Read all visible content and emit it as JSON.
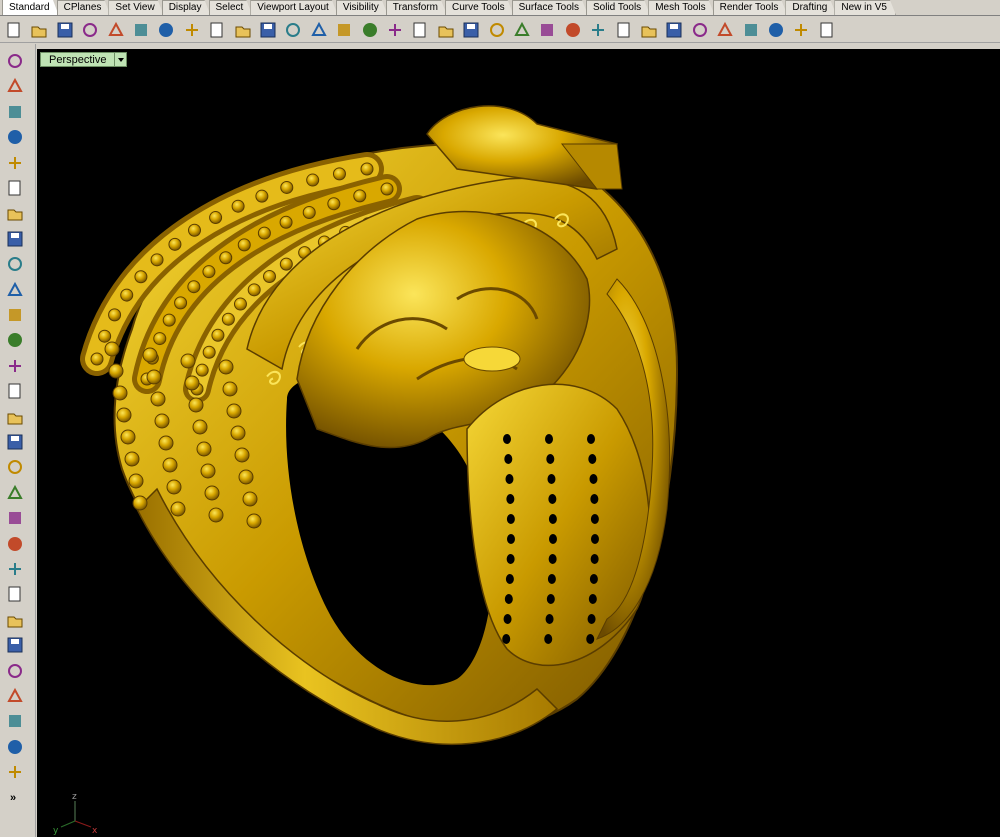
{
  "tabs": [
    {
      "label": "Standard",
      "active": true
    },
    {
      "label": "CPlanes"
    },
    {
      "label": "Set View"
    },
    {
      "label": "Display"
    },
    {
      "label": "Select"
    },
    {
      "label": "Viewport Layout"
    },
    {
      "label": "Visibility"
    },
    {
      "label": "Transform"
    },
    {
      "label": "Curve Tools"
    },
    {
      "label": "Surface Tools"
    },
    {
      "label": "Solid Tools"
    },
    {
      "label": "Mesh Tools"
    },
    {
      "label": "Render Tools"
    },
    {
      "label": "Drafting"
    },
    {
      "label": "New in V5"
    }
  ],
  "toolbar_icons": [
    "new-file-icon",
    "open-folder-icon",
    "save-icon",
    "print-icon",
    "import-icon",
    "cut-icon",
    "copy-icon",
    "paste-icon",
    "undo-icon",
    "pan-hand-icon",
    "move-view-icon",
    "rotate-view-icon",
    "zoom-dynamic-icon",
    "zoom-extents-icon",
    "zoom-window-icon",
    "zoom-selected-icon",
    "viewport-layout-icon",
    "car-icon",
    "camera-icon",
    "circle-plus-icon",
    "snap-grid-icon",
    "light-bulb-icon",
    "lock-icon",
    "color-palette-icon",
    "color-wheel-icon",
    "render-sphere-icon",
    "shade-sphere-icon",
    "ghost-sphere-icon",
    "blue-sphere-icon",
    "pin-icon",
    "gear-icon",
    "osnap-icon",
    "help-icon"
  ],
  "left_icons": [
    "select-arrow-icon",
    "point-icon",
    "polyline-icon",
    "curve-icon",
    "circle-icon",
    "ellipse-icon",
    "arc-icon",
    "rectangle-icon",
    "polygon-icon",
    "fillet-icon",
    "surface-icon",
    "extrude-icon",
    "box-solid-icon",
    "sphere-solid-icon",
    "cylinder-solid-icon",
    "plane-icon",
    "puzzle-icon",
    "move-icon",
    "trim-icon",
    "split-icon",
    "boolean-icon",
    "group-icon",
    "curve-edit-icon",
    "bend-icon",
    "text-icon",
    "array-icon",
    "transform-icon",
    "analyze-icon",
    "mesh-icon"
  ],
  "more_label": "»",
  "viewport": {
    "title": "Perspective",
    "background": "#000000",
    "axes": {
      "z": "z",
      "x": "x",
      "y": "y"
    }
  },
  "colors": {
    "gold": "#d8a800",
    "gold_light": "#f4d83a",
    "gold_dark": "#8a6200",
    "label_green": "#bfe3b4"
  }
}
